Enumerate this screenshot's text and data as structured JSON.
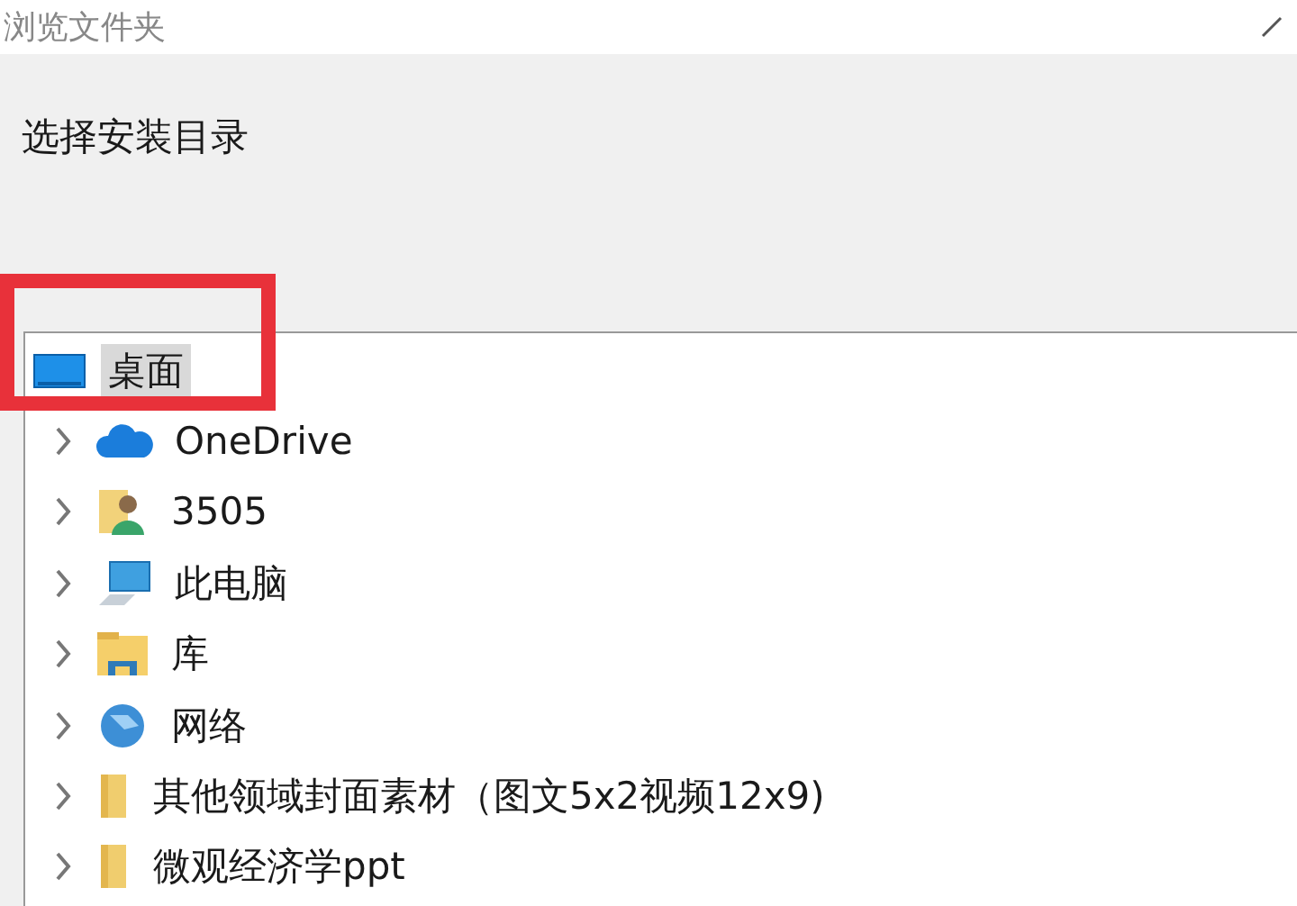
{
  "window": {
    "title": "浏览文件夹"
  },
  "instruction": "选择安装目录",
  "tree": [
    {
      "label": "桌面",
      "kind": "desktop",
      "selected": true,
      "children": [
        {
          "label": "OneDrive",
          "kind": "cloud",
          "selected": false,
          "expanded": false
        },
        {
          "label": "3505",
          "kind": "user",
          "selected": false,
          "expanded": false
        },
        {
          "label": "此电脑",
          "kind": "computer",
          "selected": false,
          "expanded": false
        },
        {
          "label": "库",
          "kind": "library",
          "selected": false,
          "expanded": false
        },
        {
          "label": "网络",
          "kind": "network",
          "selected": false,
          "expanded": false
        },
        {
          "label": "其他领域封面素材（图文5x2视频12x9)",
          "kind": "folder",
          "selected": false,
          "expanded": false
        },
        {
          "label": "微观经济学ppt",
          "kind": "folder",
          "selected": false,
          "expanded": false
        }
      ]
    }
  ],
  "annotation": {
    "kind": "rectangle"
  }
}
